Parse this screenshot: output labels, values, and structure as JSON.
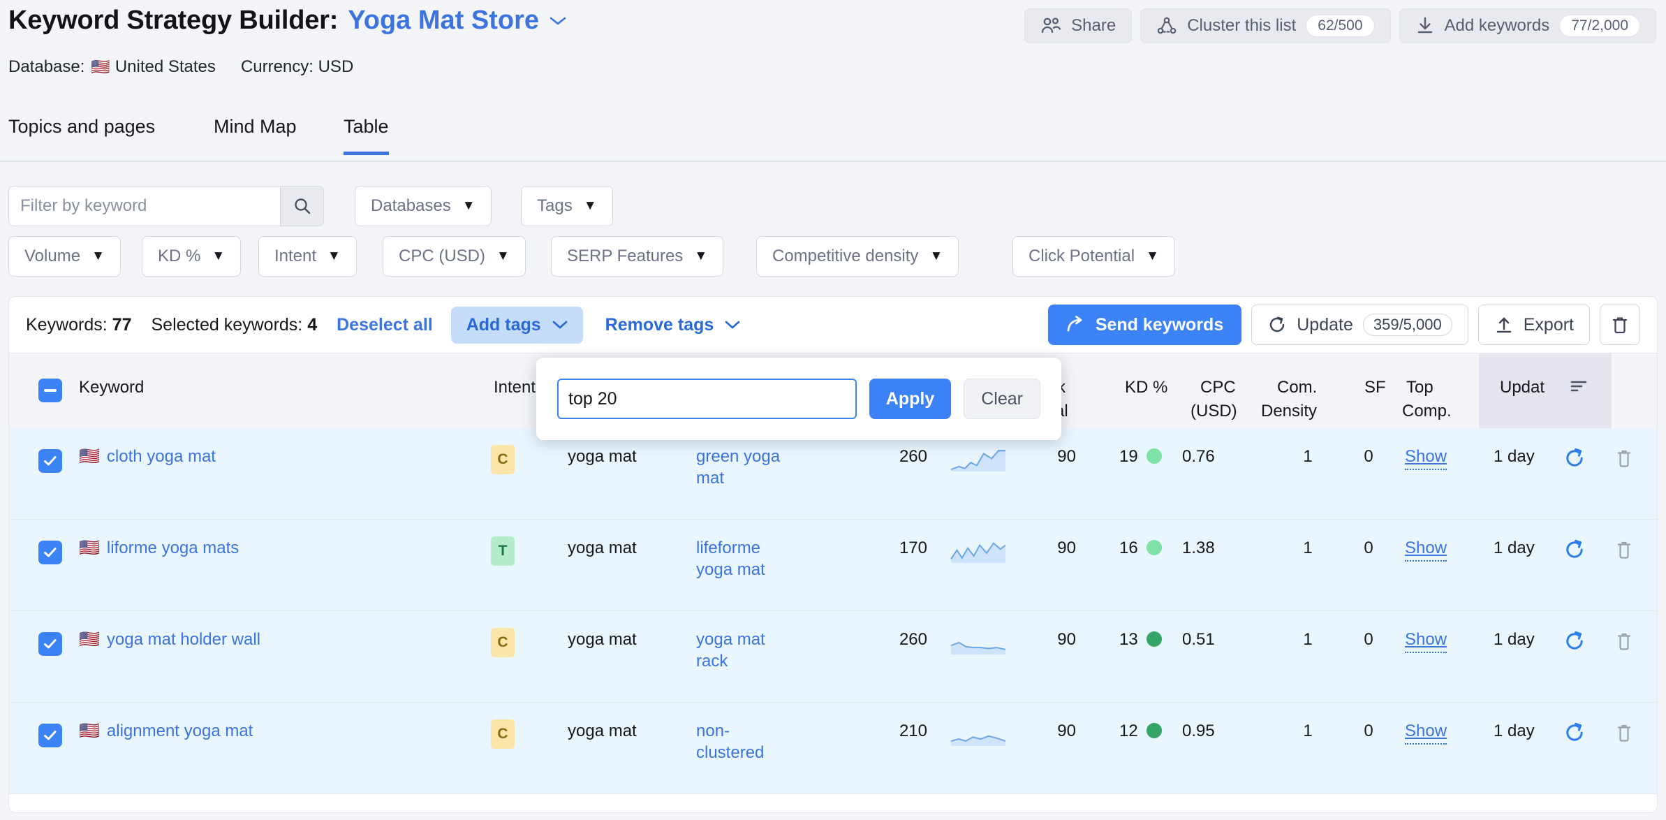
{
  "header": {
    "title_prefix": "Keyword Strategy Builder:",
    "project_name": "Yoga Mat Store",
    "database_label": "Database:",
    "database_value": "United States",
    "currency_label": "Currency: USD",
    "actions": {
      "share": "Share",
      "cluster": "Cluster this list",
      "cluster_count": "62/500",
      "add_keywords": "Add keywords",
      "add_keywords_count": "77/2,000"
    }
  },
  "tabs": [
    {
      "label": "Topics and pages",
      "active": false
    },
    {
      "label": "Mind Map",
      "active": false
    },
    {
      "label": "Table",
      "active": true
    }
  ],
  "filters": {
    "search_placeholder": "Filter by keyword",
    "search_value": "",
    "dropdowns": [
      "Databases",
      "Tags",
      "Volume",
      "KD %",
      "Intent",
      "CPC (USD)",
      "SERP Features",
      "Competitive density",
      "Click Potential"
    ]
  },
  "toolbar": {
    "keywords_label": "Keywords:",
    "keywords_count": "77",
    "selected_label": "Selected keywords:",
    "selected_count": "4",
    "deselect_all": "Deselect all",
    "add_tags": "Add tags",
    "remove_tags": "Remove tags",
    "send_keywords": "Send keywords",
    "update": "Update",
    "update_count": "359/5,000",
    "export": "Export"
  },
  "tag_popup": {
    "input_value": "top 20",
    "apply_label": "Apply",
    "clear_label": "Clear"
  },
  "table": {
    "columns": {
      "keyword": "Keyword",
      "intent": "Intent",
      "kd": "KD %",
      "cpc": "CPC\n(USD)",
      "cpc_line1": "CPC",
      "cpc_line2": "(USD)",
      "com_line1": "Com.",
      "com_line2": "Density",
      "sf": "SF",
      "top_line1": "Top",
      "top_line2": "Comp.",
      "updated": "Updat",
      "hidden_col_line1": "k",
      "hidden_col_line2": "al"
    },
    "rows": [
      {
        "keyword": "cloth yoga mat",
        "intent": "C",
        "intent_type": "c",
        "topic": "yoga mat",
        "cluster": "green yoga mat",
        "volume": "260",
        "trend": "up",
        "kd_right": "90",
        "kd": "19",
        "kd_color": "#7ee2a8",
        "cpc": "0.76",
        "com_density": "1",
        "sf": "0",
        "top_comp": "Show",
        "updated": "1 day"
      },
      {
        "keyword": "liforme yoga mats",
        "intent": "T",
        "intent_type": "t",
        "topic": "yoga mat",
        "cluster": "lifeforme yoga mat",
        "volume": "170",
        "trend": "jagged",
        "kd_right": "90",
        "kd": "16",
        "kd_color": "#7ee2a8",
        "cpc": "1.38",
        "com_density": "1",
        "sf": "0",
        "top_comp": "Show",
        "updated": "1 day"
      },
      {
        "keyword": "yoga mat holder wall",
        "intent": "C",
        "intent_type": "c",
        "topic": "yoga mat",
        "cluster": "yoga mat rack",
        "volume": "260",
        "trend": "flat-down",
        "kd_right": "90",
        "kd": "13",
        "kd_color": "#34a469",
        "cpc": "0.51",
        "com_density": "1",
        "sf": "0",
        "top_comp": "Show",
        "updated": "1 day"
      },
      {
        "keyword": "alignment yoga mat",
        "intent": "C",
        "intent_type": "c",
        "topic": "yoga mat",
        "cluster": "non-clustered",
        "volume": "210",
        "trend": "wavy",
        "kd_right": "90",
        "kd": "12",
        "kd_color": "#34a469",
        "cpc": "0.95",
        "com_density": "1",
        "sf": "0",
        "top_comp": "Show",
        "updated": "1 day"
      }
    ]
  },
  "colors": {
    "accent": "#3b73df",
    "primary": "#3b82f6",
    "row_selected": "#eaf6fd",
    "page_bg": "#f4f5f9"
  },
  "icons": {
    "share": "share-people-icon",
    "cluster": "cluster-icon",
    "download": "download-icon",
    "search": "search-icon",
    "send": "send-arrow-icon",
    "refresh": "refresh-icon",
    "upload": "upload-icon",
    "trash": "trash-icon",
    "sort": "sort-icon",
    "flag": "us-flag-icon"
  }
}
